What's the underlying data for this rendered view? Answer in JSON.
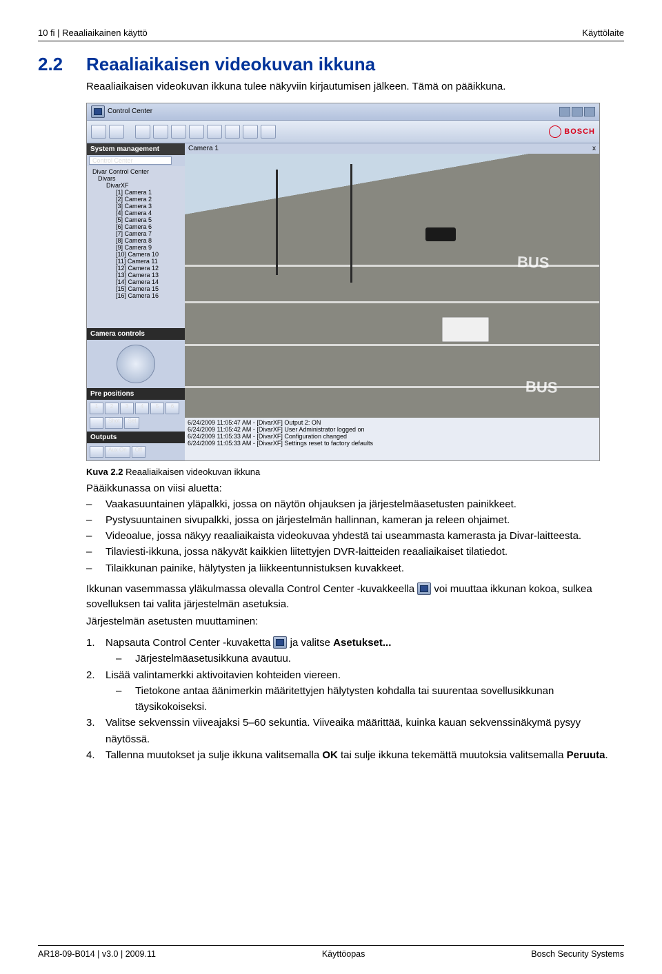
{
  "header": {
    "left": "10    fi | Reaaliaikainen käyttö",
    "right": "Käyttölaite"
  },
  "section": {
    "number": "2.2",
    "title": "Reaaliaikaisen videokuvan ikkuna"
  },
  "intro": "Reaaliaikaisen videokuvan ikkuna tulee näkyviin kirjautumisen jälkeen. Tämä on pääikkuna.",
  "app": {
    "title": "Control Center",
    "system_management": "System management",
    "combo_value": "Control Center",
    "tree_root": "Divar Control Center",
    "tree_parent": "DivarXF",
    "tree_divars": "Divars",
    "cameras": [
      "[1] Camera 1",
      "[2] Camera 2",
      "[3] Camera 3",
      "[4] Camera 4",
      "[5] Camera 5",
      "[6] Camera 6",
      "[7] Camera 7",
      "[8] Camera 8",
      "[9] Camera 9",
      "[10] Camera 10",
      "[11] Camera 11",
      "[12] Camera 12",
      "[13] Camera 13",
      "[14] Camera 14",
      "[15] Camera 15",
      "[16] Camera 16"
    ],
    "camera_controls": "Camera controls",
    "pre_positions": "Pre positions",
    "presets": [
      "1",
      "2",
      "3",
      "4",
      "5",
      "6"
    ],
    "pre_btn_shot": "Shot",
    "pre_btn_set": "Set",
    "outputs_label": "Outputs",
    "out_auxon": "Aux On",
    "out_off": "Off",
    "brand": "BOSCH",
    "cam_header": "Camera 1",
    "close_x": "x",
    "bus1": "BUS",
    "bus2": "BUS",
    "log": [
      "6/24/2009 11:05:47 AM - [DivarXF] Output 2: ON",
      "6/24/2009 11:05:42 AM - [DivarXF] User Administrator logged on",
      "6/24/2009 11:05:33 AM - [DivarXF] Configuration changed",
      "6/24/2009 11:05:33 AM - [DivarXF] Settings reset to factory defaults"
    ]
  },
  "figure": {
    "label": "Kuva 2.2",
    "caption": "Reaaliaikaisen videokuvan ikkuna"
  },
  "paa": "Pääikkunassa on viisi aluetta:",
  "bullets": [
    "Vaakasuuntainen yläpalkki, jossa on näytön ohjauksen ja järjestelmäasetusten painikkeet.",
    "Pystysuuntainen sivupalkki, jossa on järjestelmän hallinnan, kameran ja releen ohjaimet.",
    "Videoalue, jossa näkyy reaaliaikaista videokuvaa yhdestä tai useammasta kamerasta ja Divar-laitteesta.",
    "Tilaviesti-ikkuna, jossa näkyvät kaikkien liitettyjen DVR-laitteiden reaaliaikaiset tilatiedot.",
    "Tilaikkunan painike, hälytysten ja liikkeentunnistuksen kuvakkeet."
  ],
  "para_after_bullets_a": "Ikkunan vasemmassa yläkulmassa olevalla Control Center -kuvakkeella ",
  "para_after_bullets_b": " voi muuttaa ikkunan kokoa, sulkea sovelluksen tai valita järjestelmän asetuksia.",
  "settings_hdr": "Järjestelmän asetusten muuttaminen:",
  "steps": {
    "s1a": "Napsauta Control Center -kuvaketta ",
    "s1b": " ja valitse ",
    "s1bold": "Asetukset...",
    "s1sub": "Järjestelmäasetusikkuna avautuu.",
    "s2": "Lisää valintamerkki aktivoitavien kohteiden viereen.",
    "s2sub": "Tietokone antaa äänimerkin määritettyjen hälytysten kohdalla tai suurentaa sovellusikkunan täysikokoiseksi.",
    "s3": "Valitse sekvenssin viiveajaksi 5–60 sekuntia. Viiveaika määrittää, kuinka kauan sekvenssinäkymä pysyy näytössä.",
    "s4a": "Tallenna muutokset ja sulje ikkuna valitsemalla ",
    "s4ok": "OK",
    "s4b": " tai sulje ikkuna tekemättä muutoksia valitsemalla ",
    "s4cancel": "Peruuta",
    "s4c": "."
  },
  "footer": {
    "left": "AR18-09-B014 | v3.0 | 2009.11",
    "center": "Käyttöopas",
    "right": "Bosch Security Systems"
  }
}
